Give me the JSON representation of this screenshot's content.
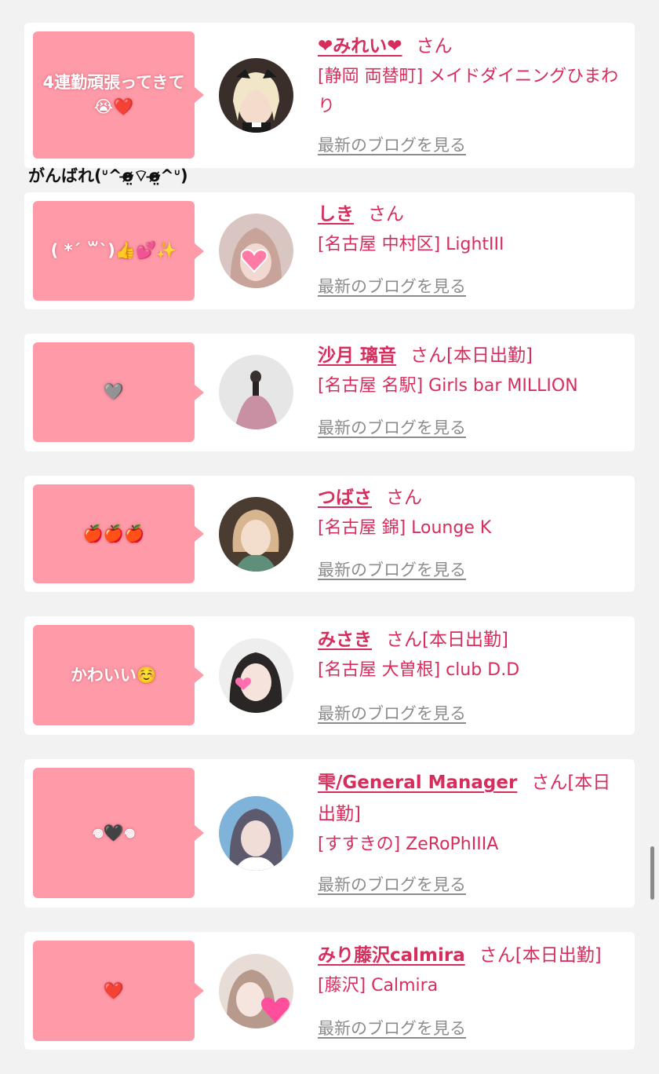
{
  "floating_comment": "がんばれ(ᐡ^o̴̶̷̤⌔o̴̶̷̤^ᐡ)",
  "blog_link_label": "最新のブログを見る",
  "san_suffix": "さん",
  "colors": {
    "background": "#f2f2f2",
    "card": "#ffffff",
    "bubble": "#ff9aa8",
    "accent": "#d62d5c",
    "link_gray": "#8c8c8c"
  },
  "entries": [
    {
      "comment": "4連勤頑張ってきて😭❤️",
      "name": "❤みれい❤",
      "san": "さん",
      "status": "",
      "shop": "[静岡 両替町] メイドダイニングひまわり",
      "avatar_icon": "cast-avatar"
    },
    {
      "comment": "( *ˊ ꒳ˋ)👍💕✨",
      "name": "しき",
      "san": "さん",
      "status": "",
      "shop": "[名古屋 中村区] LightIII",
      "avatar_icon": "cast-avatar"
    },
    {
      "comment": "🩶",
      "name": "沙月 璃音",
      "san": "さん",
      "status": "[本日出勤]",
      "shop": "[名古屋 名駅] Girls bar MILLION",
      "avatar_icon": "cast-avatar"
    },
    {
      "comment": "🍎🍎🍎",
      "name": "つばさ",
      "san": "さん",
      "status": "",
      "shop": "[名古屋 錦] Lounge K",
      "avatar_icon": "cast-avatar"
    },
    {
      "comment": "かわいい☺️",
      "name": "みさき",
      "san": "さん",
      "status": "[本日出勤]",
      "shop": "[名古屋 大曽根] club D.D",
      "avatar_icon": "cast-avatar"
    },
    {
      "comment": "𖦹🖤𖦹",
      "name": "雫/General Manager",
      "san": "さん",
      "status": "[本日出勤]",
      "shop": "[すすきの] ZeRoPhIIIA",
      "avatar_icon": "cast-avatar"
    },
    {
      "comment": "❤️",
      "name": "みり藤沢calmira",
      "san": "さん",
      "status": "[本日出勤]",
      "shop": "[藤沢] Calmira",
      "avatar_icon": "cast-avatar"
    }
  ]
}
